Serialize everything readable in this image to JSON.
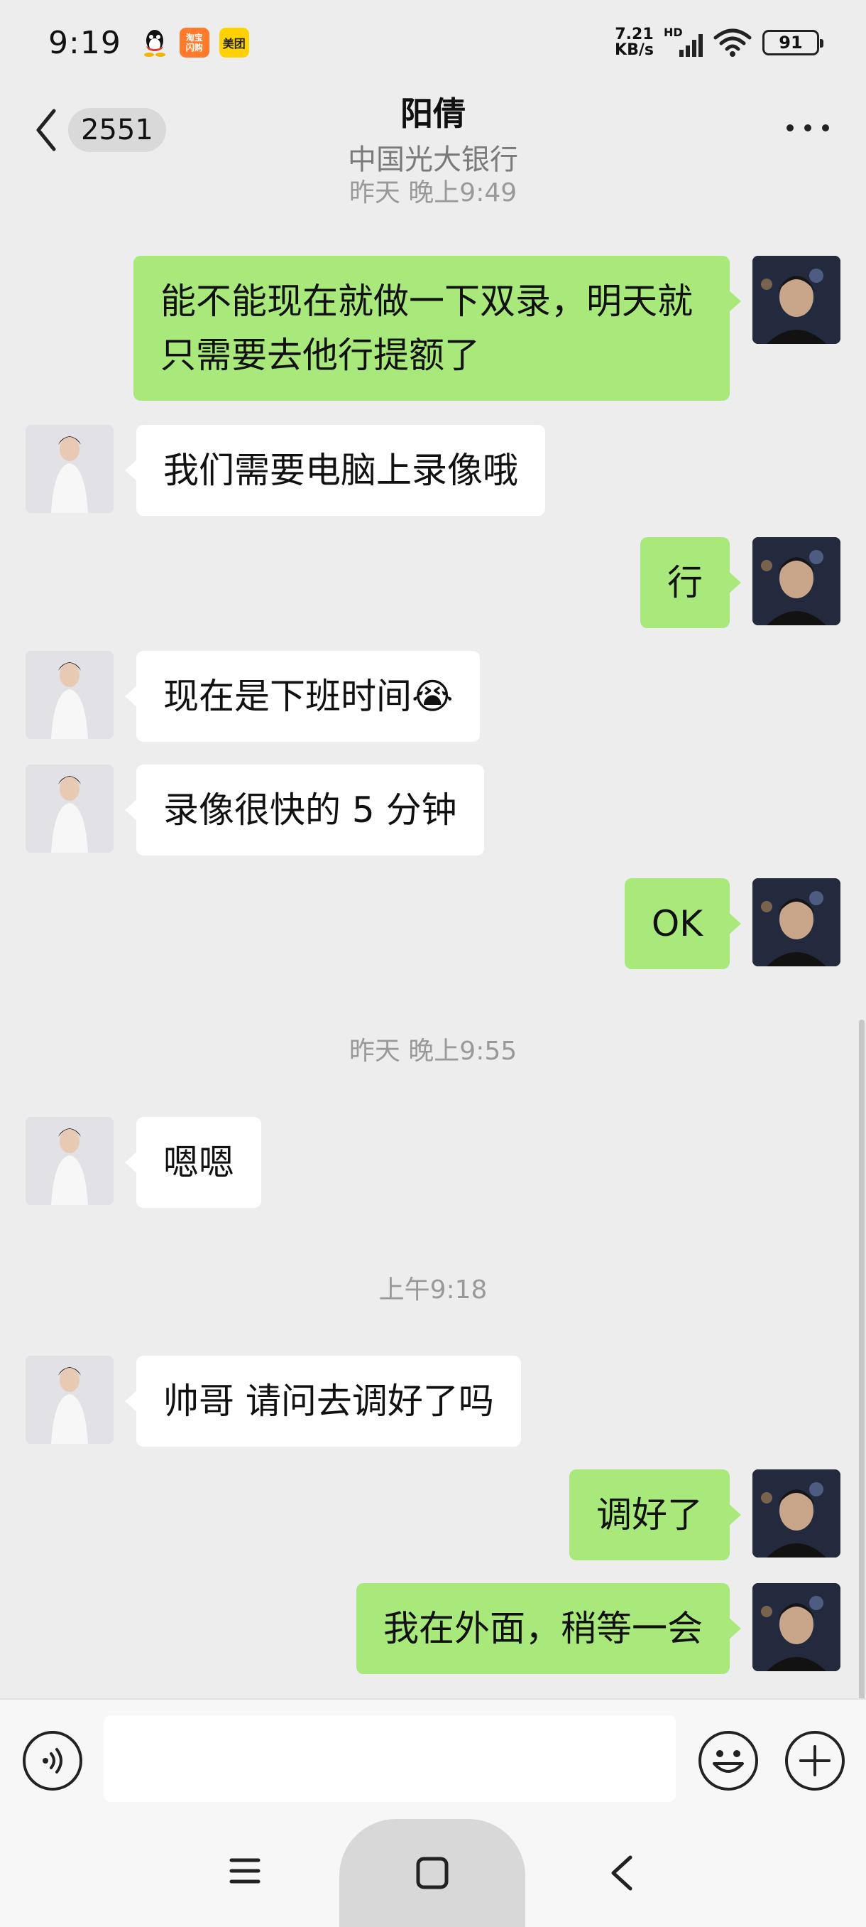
{
  "status_bar": {
    "time": "9:19",
    "net_speed_value": "7.21",
    "net_speed_unit": "KB/s",
    "hd_label": "HD",
    "battery": "91",
    "apps": {
      "taobao_label": "淘宝\n闪购",
      "meituan_label": "美团"
    },
    "icons": [
      "qq-icon",
      "taobao-icon",
      "meituan-icon",
      "signal-icon",
      "wifi-icon",
      "battery-icon"
    ]
  },
  "header": {
    "unread_count": "2551",
    "title": "阳倩",
    "subtitle": "中国光大银行"
  },
  "chat": {
    "top_timestamp_partial": "昨天 晚上9:49",
    "messages": [
      {
        "side": "right",
        "text": "能不能现在就做一下双录，明天就只需要去他行提额了"
      },
      {
        "side": "left",
        "text": "我们需要电脑上录像哦"
      },
      {
        "side": "right",
        "text": "行"
      },
      {
        "side": "left",
        "text": "现在是下班时间😭"
      },
      {
        "side": "left",
        "text": "录像很快的 5 分钟"
      },
      {
        "side": "right",
        "text": "OK"
      },
      {
        "side": "left",
        "text": "嗯嗯"
      },
      {
        "side": "left",
        "text": "帅哥 请问去调好了吗"
      },
      {
        "side": "right",
        "text": "调好了"
      },
      {
        "side": "right",
        "text": "我在外面，稍等一会"
      }
    ],
    "timestamps": [
      "昨天 晚上9:55",
      "上午9:18"
    ]
  },
  "input_bar": {
    "placeholder": "",
    "icons": [
      "voice-icon",
      "emoji-icon",
      "plus-icon"
    ]
  },
  "nav_bar": {
    "icons": [
      "menu-icon",
      "home-icon",
      "back-icon"
    ]
  },
  "colors": {
    "background": "#ededed",
    "sent_bubble": "#a9e97b",
    "received_bubble": "#ffffff"
  }
}
